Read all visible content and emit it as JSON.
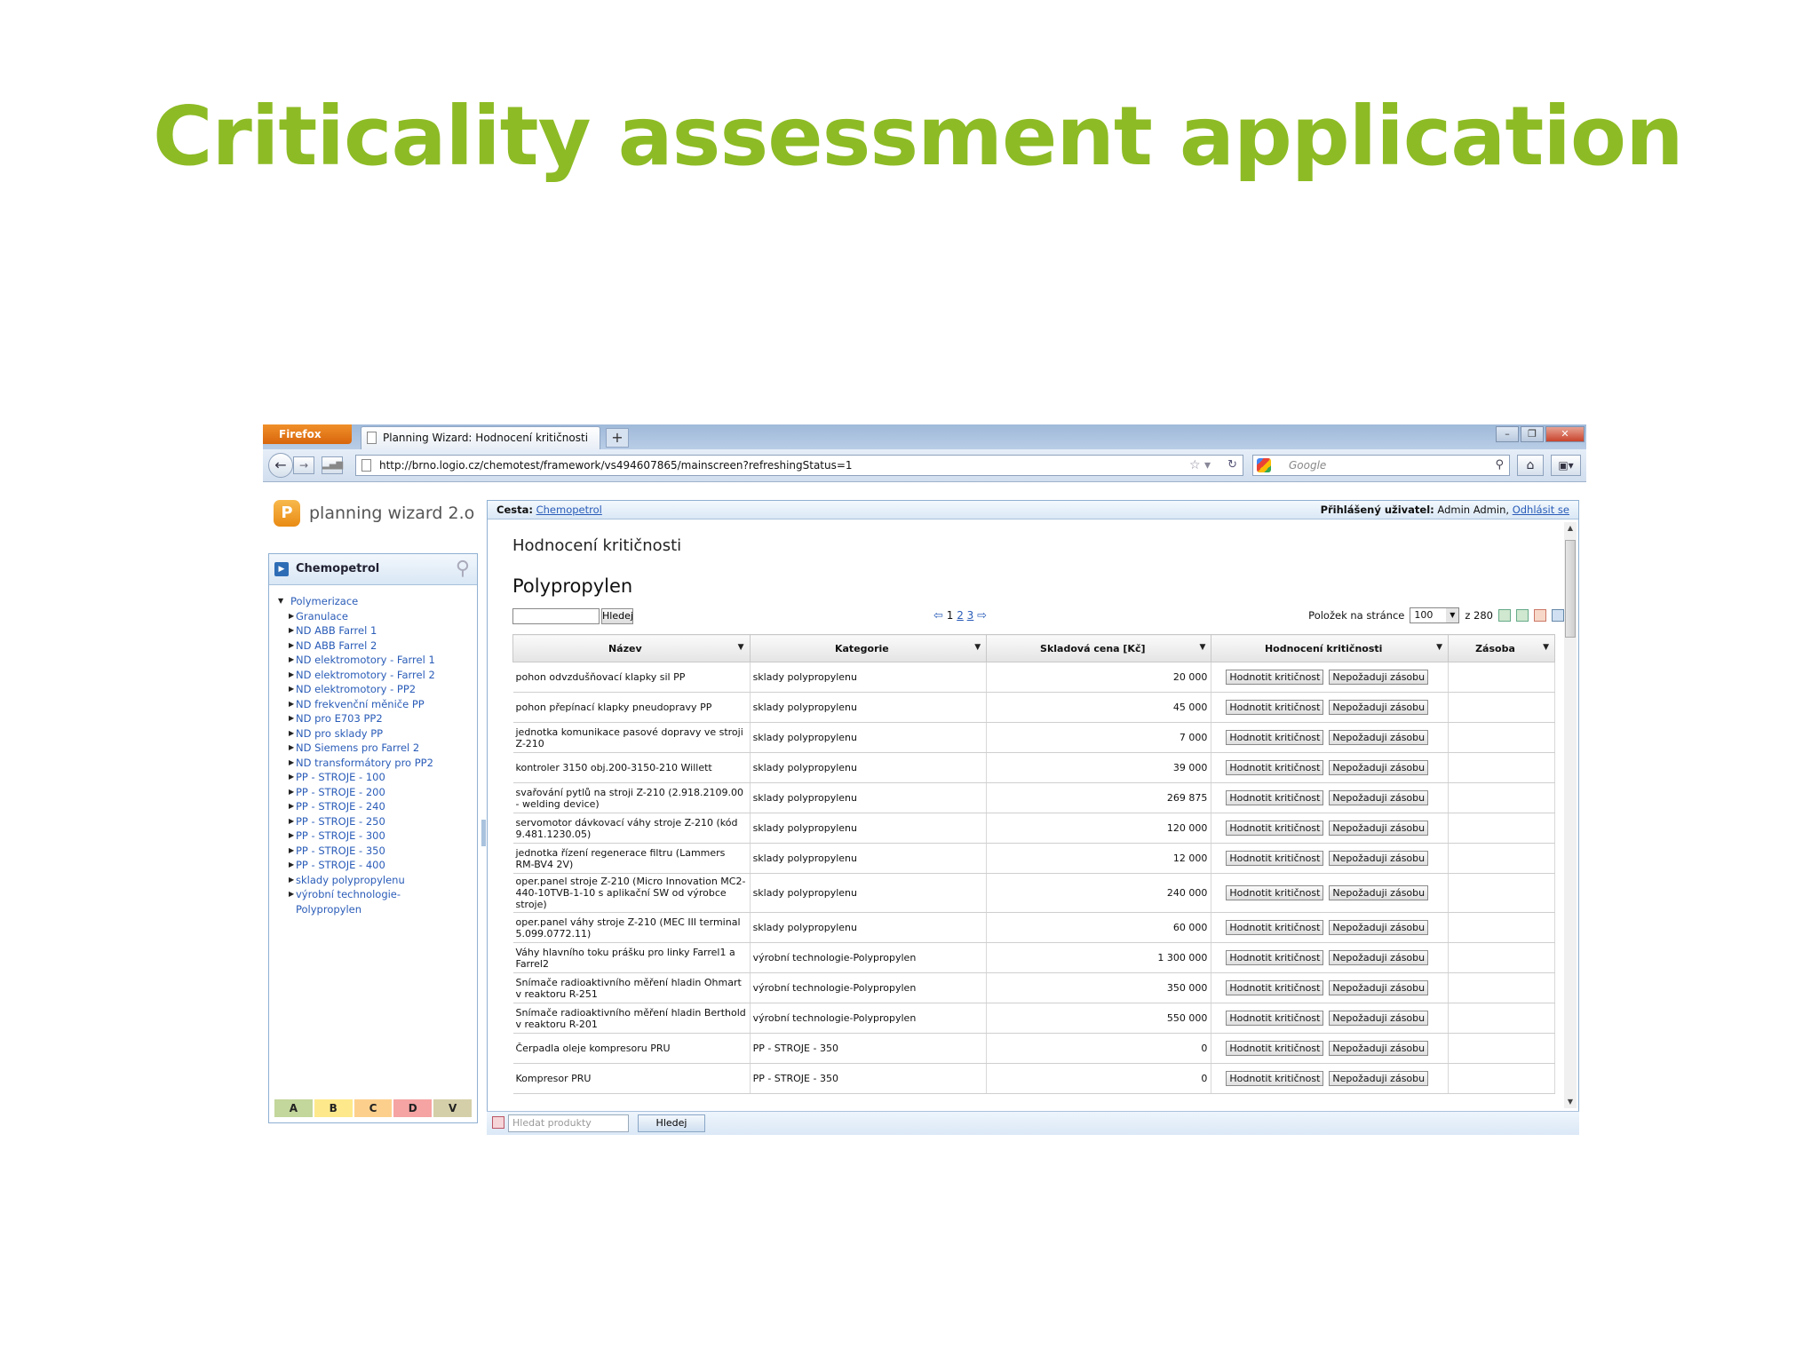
{
  "slide": {
    "title": "Criticality assessment application"
  },
  "browser": {
    "menu_label": "Firefox",
    "tab_title": "Planning Wizard: Hodnocení kritičnosti",
    "new_tab": "+",
    "url": "http://brno.logio.cz/chemotest/framework/vs494607865/mainscreen?refreshingStatus=1",
    "search_placeholder": "Google"
  },
  "app": {
    "logo_text": "planning wizard 2.o",
    "path_label": "Cesta:",
    "path_link": "Chemopetrol",
    "user_label": "Přihlášený uživatel:",
    "user_name": "Admin Admin,",
    "logout": "Odhlásit se"
  },
  "sidebar": {
    "title": "Chemopetrol",
    "root": "Polymerizace",
    "items": [
      "Granulace",
      "ND ABB Farrel 1",
      "ND ABB Farrel 2",
      "ND elektromotory - Farrel 1",
      "ND elektromotory - Farrel 2",
      "ND elektromotory - PP2",
      "ND frekvenční měniče PP",
      "ND pro E703 PP2",
      "ND pro sklady PP",
      "ND Siemens pro Farrel 2",
      "ND transformátory pro PP2",
      "PP - STROJE - 100",
      "PP - STROJE - 200",
      "PP - STROJE - 240",
      "PP - STROJE - 250",
      "PP - STROJE - 300",
      "PP - STROJE - 350",
      "PP - STROJE - 400",
      "sklady polypropylenu",
      "výrobní technologie-",
      "Polypropylen"
    ],
    "abcd": [
      {
        "label": "A",
        "color": "#c3d69b"
      },
      {
        "label": "B",
        "color": "#fde98b"
      },
      {
        "label": "C",
        "color": "#fcd08c"
      },
      {
        "label": "D",
        "color": "#f5a3a3"
      },
      {
        "label": "V",
        "color": "#d4cfa8"
      }
    ]
  },
  "content": {
    "heading": "Hodnocení kritičnosti",
    "subheading": "Polypropylen",
    "search_button": "Hledej",
    "pages": [
      "1",
      "2",
      "3"
    ],
    "per_page_label": "Položek na stránce",
    "per_page_value": "100",
    "total": "z 280",
    "columns": [
      "Název",
      "Kategorie",
      "Skladová cena [Kč]",
      "Hodnocení kritičnosti",
      "Zásoba"
    ],
    "btn_assess": "Hodnotit kritičnost",
    "btn_nostock": "Nepožaduji zásobu",
    "rows": [
      {
        "name": "pohon odvzdušňovací klapky sil PP",
        "category": "sklady polypropylenu",
        "price": "20 000"
      },
      {
        "name": "pohon přepínací klapky pneudopravy PP",
        "category": "sklady polypropylenu",
        "price": "45 000"
      },
      {
        "name": "jednotka komunikace pasové dopravy ve stroji Z-210",
        "category": "sklady polypropylenu",
        "price": "7 000"
      },
      {
        "name": "kontroler 3150 obj.200-3150-210 Willett",
        "category": "sklady polypropylenu",
        "price": "39 000"
      },
      {
        "name": "svařování pytlů na stroji Z-210 (2.918.2109.00 - welding device)",
        "category": "sklady polypropylenu",
        "price": "269 875"
      },
      {
        "name": "servomotor dávkovací váhy stroje Z-210 (kód 9.481.1230.05)",
        "category": "sklady polypropylenu",
        "price": "120 000"
      },
      {
        "name": "jednotka řízení regenerace filtru (Lammers RM-BV4 2V)",
        "category": "sklady polypropylenu",
        "price": "12 000"
      },
      {
        "name": "oper.panel stroje Z-210 (Micro Innovation MC2-440-10TVB-1-10 s aplikační SW od výrobce stroje)",
        "category": "sklady polypropylenu",
        "price": "240 000"
      },
      {
        "name": "oper.panel váhy stroje Z-210 (MEC III terminal 5.099.0772.11)",
        "category": "sklady polypropylenu",
        "price": "60 000"
      },
      {
        "name": "Váhy hlavního toku prášku pro linky Farrel1 a Farrel2",
        "category": "výrobní technologie-Polypropylen",
        "price": "1 300 000"
      },
      {
        "name": "Snímače radioaktivního měření hladin Ohmart v reaktoru R-251",
        "category": "výrobní technologie-Polypropylen",
        "price": "350 000"
      },
      {
        "name": "Snímače radioaktivního měření hladin Berthold v reaktoru R-201",
        "category": "výrobní technologie-Polypropylen",
        "price": "550 000"
      },
      {
        "name": "Čerpadla oleje kompresoru PRU",
        "category": "PP - STROJE - 350",
        "price": "0"
      },
      {
        "name": "Kompresor PRU",
        "category": "PP - STROJE - 350",
        "price": "0"
      }
    ],
    "row_heights": [
      34,
      34,
      34,
      34,
      34,
      34,
      34,
      44,
      34,
      34,
      34,
      34,
      34,
      34
    ]
  },
  "bottom": {
    "search_placeholder": "Hledat produkty",
    "search_button": "Hledej"
  }
}
